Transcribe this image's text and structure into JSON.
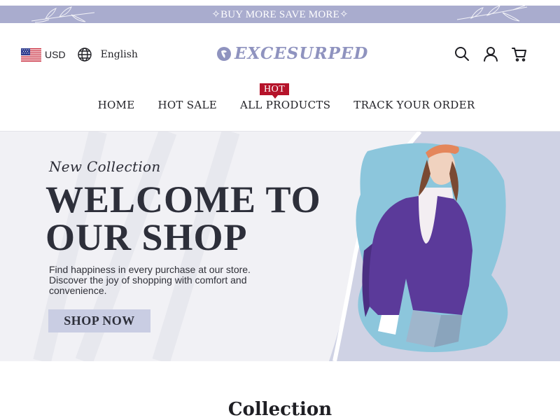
{
  "announcement": {
    "text": "BUY MORE SAVE MORE"
  },
  "header": {
    "currency": "USD",
    "language": "English",
    "logo_text": "EXCESURPED",
    "icons": [
      "search-icon",
      "account-icon",
      "cart-icon"
    ]
  },
  "nav": {
    "items": [
      {
        "label": "HOME"
      },
      {
        "label": "HOT SALE"
      },
      {
        "label": "ALL PRODUCTS",
        "badge": "HOT"
      },
      {
        "label": "TRACK YOUR ORDER"
      }
    ]
  },
  "hero": {
    "eyebrow": "New Collection",
    "title": "WELCOME TO OUR SHOP",
    "description": "Find happiness in every purchase at our store. Discover the joy of shopping with comfort and convenience.",
    "button_label": "SHOP NOW"
  },
  "collection": {
    "title": "Collection"
  },
  "colors": {
    "announcement_bg": "#a9acce",
    "logo": "#8f93bf",
    "badge": "#b5132a",
    "button_bg": "#c9cde3",
    "jacket": "#5b3a9a"
  }
}
